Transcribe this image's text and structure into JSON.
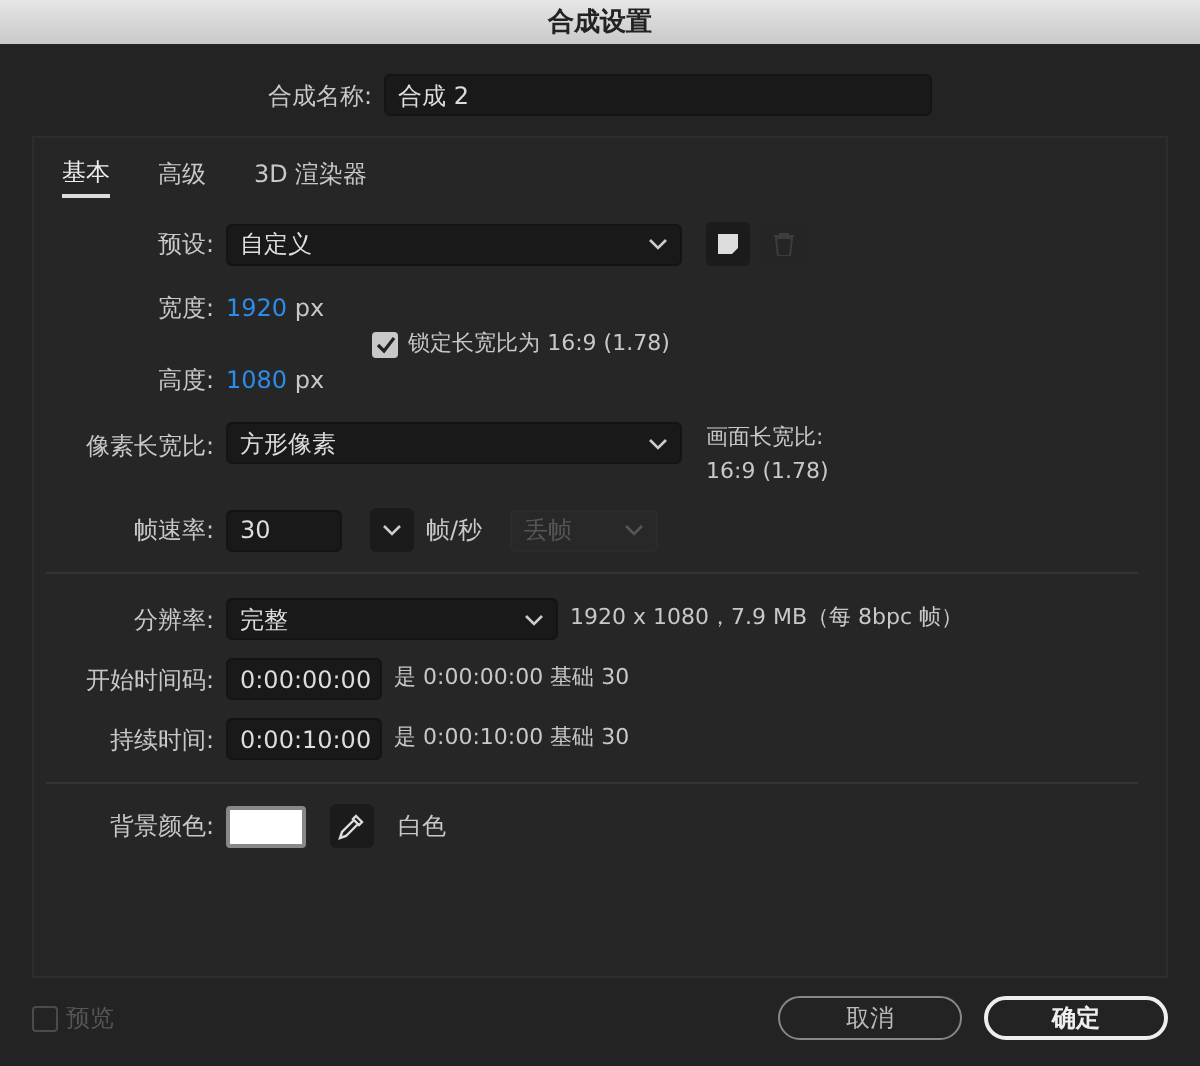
{
  "window": {
    "title": "合成设置"
  },
  "comp_name": {
    "label": "合成名称:",
    "value": "合成 2"
  },
  "tabs": [
    {
      "label": "基本",
      "selected": true
    },
    {
      "label": "高级",
      "selected": false
    },
    {
      "label": "3D 渲染器",
      "selected": false
    }
  ],
  "preset": {
    "label": "预设:",
    "value": "自定义",
    "new_disabled": false,
    "delete_disabled": true
  },
  "width": {
    "label": "宽度:",
    "value": "1920",
    "unit": "px"
  },
  "lock_aspect": {
    "label": "锁定长宽比为 16:9 (1.78)",
    "checked": true
  },
  "height": {
    "label": "高度:",
    "value": "1080",
    "unit": "px"
  },
  "pixel_aspect": {
    "label": "像素长宽比:",
    "value": "方形像素"
  },
  "frame_aspect": {
    "label": "画面长宽比:",
    "value": "16:9 (1.78)"
  },
  "frame_rate": {
    "label": "帧速率:",
    "value": "30",
    "unit": "帧/秒",
    "drop_frame": {
      "value": "丢帧",
      "disabled": true
    }
  },
  "resolution": {
    "label": "分辨率:",
    "value": "完整",
    "info": "1920 x 1080，7.9 MB（每 8bpc 帧）"
  },
  "start_timecode": {
    "label": "开始时间码:",
    "value": "0:00:00:00",
    "note": "是 0:00:00:00 基础 30"
  },
  "duration": {
    "label": "持续时间:",
    "value": "0:00:10:00",
    "note": "是 0:00:10:00 基础 30"
  },
  "background": {
    "label": "背景颜色:",
    "color": "#ffffff",
    "name": "白色"
  },
  "preview": {
    "label": "预览",
    "checked": false,
    "disabled": true
  },
  "buttons": [
    {
      "label": "取消",
      "kind": "secondary"
    },
    {
      "label": "确定",
      "kind": "primary"
    }
  ]
}
